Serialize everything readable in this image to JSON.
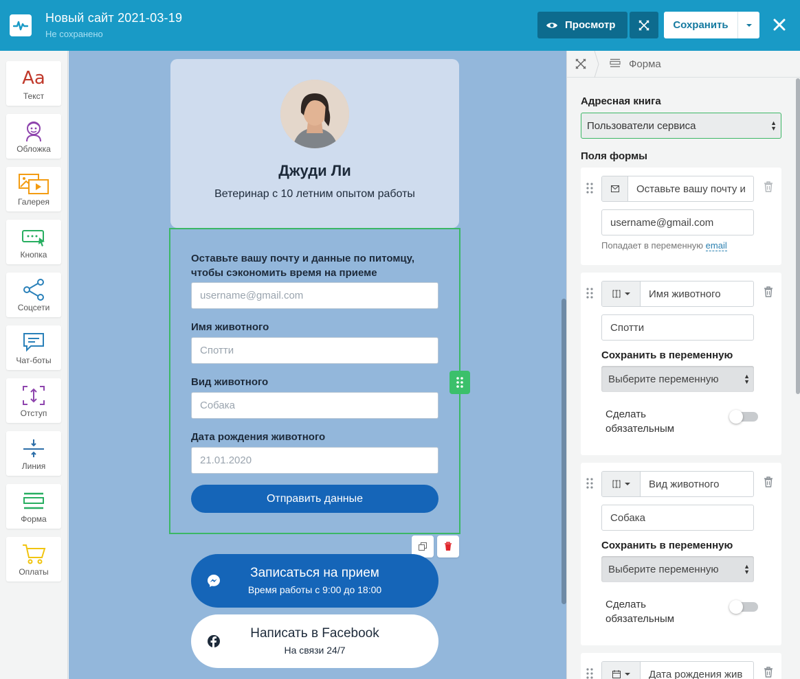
{
  "header": {
    "site_title": "Новый сайт 2021-03-19",
    "status": "Не сохранено",
    "preview_label": "Просмотр",
    "save_label": "Сохранить",
    "accent": "#199ac6"
  },
  "tools": [
    {
      "label": "Текст",
      "icon": "text-icon"
    },
    {
      "label": "Обложка",
      "icon": "cover-icon"
    },
    {
      "label": "Галерея",
      "icon": "gallery-icon"
    },
    {
      "label": "Кнопка",
      "icon": "button-icon"
    },
    {
      "label": "Соцсети",
      "icon": "share-icon"
    },
    {
      "label": "Чат-боты",
      "icon": "chatbot-icon"
    },
    {
      "label": "Отступ",
      "icon": "spacing-icon"
    },
    {
      "label": "Линия",
      "icon": "line-icon"
    },
    {
      "label": "Форма",
      "icon": "form-icon"
    },
    {
      "label": "Оплаты",
      "icon": "cart-icon"
    }
  ],
  "profile": {
    "name": "Джуди Ли",
    "description": "Ветеринар с 10 летним опытом работы"
  },
  "form": {
    "fields": [
      {
        "label": "Оставьте вашу почту и данные по питомцу,",
        "label2": "чтобы сэкономить время на приеме",
        "placeholder": "username@gmail.com"
      },
      {
        "label": "Имя животного",
        "placeholder": "Спотти"
      },
      {
        "label": "Вид животного",
        "placeholder": "Собака"
      },
      {
        "label": "Дата рождения животного",
        "placeholder": "21.01.2020"
      }
    ],
    "submit_label": "Отправить данные"
  },
  "cta": [
    {
      "title": "Записаться на прием",
      "subtitle": "Время работы с 9:00 до 18:00",
      "icon": "messenger-icon"
    },
    {
      "title": "Написать в Facebook",
      "subtitle": "На связи 24/7",
      "icon": "facebook-icon"
    }
  ],
  "panel": {
    "breadcrumb": "Форма",
    "address_book_title": "Адресная книга",
    "address_book_value": "Пользователи сервиса",
    "fields_title": "Поля формы",
    "cards": [
      {
        "label": "Оставьте вашу почту и",
        "placeholder": "username@gmail.com",
        "hint": "Попадает в переменную",
        "hint_var": "email"
      },
      {
        "label": "Имя животного",
        "placeholder": "Спотти",
        "save_var": "Сохранить в переменную",
        "var_value": "Выберите переменную",
        "required_1": "Сделать",
        "required_2": "обязательным"
      },
      {
        "label": "Вид животного",
        "placeholder": "Собака",
        "save_var": "Сохранить в переменную",
        "var_value": "Выберите переменную",
        "required_1": "Сделать",
        "required_2": "обязательным"
      },
      {
        "label": "Дата рождения жив"
      }
    ]
  }
}
